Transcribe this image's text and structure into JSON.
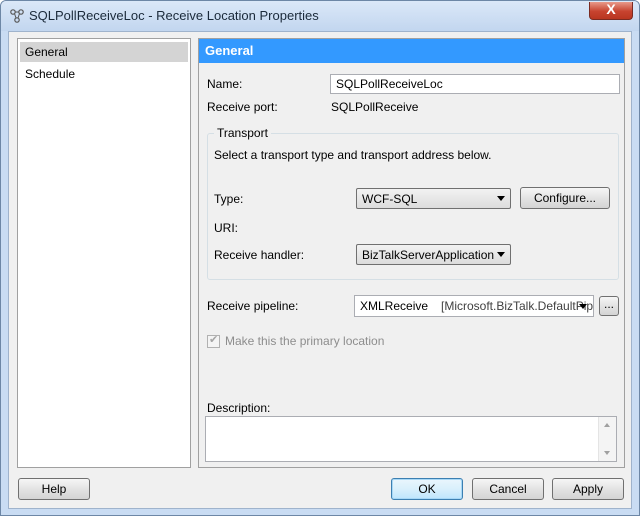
{
  "window": {
    "title": "SQLPollReceiveLoc - Receive Location Properties",
    "close_label": "X"
  },
  "nav": {
    "items": [
      {
        "label": "General"
      },
      {
        "label": "Schedule"
      }
    ]
  },
  "panel": {
    "header": "General",
    "name_label": "Name:",
    "name_value": "SQLPollReceiveLoc",
    "receive_port_label": "Receive port:",
    "receive_port_value": "SQLPollReceive",
    "transport": {
      "title": "Transport",
      "hint": "Select a transport type and transport address below.",
      "type_label": "Type:",
      "type_value": "WCF-SQL",
      "configure_label": "Configure...",
      "uri_label": "URI:",
      "handler_label": "Receive handler:",
      "handler_value": "BizTalkServerApplication"
    },
    "pipeline_label": "Receive pipeline:",
    "pipeline_name": "XMLReceive",
    "pipeline_assembly": "[Microsoft.BizTalk.DefaultPip",
    "pipeline_browse_label": "...",
    "primary_location_label": "Make this the primary location",
    "primary_location_checked": true,
    "description_label": "Description:",
    "description_value": ""
  },
  "footer": {
    "help": "Help",
    "ok": "OK",
    "cancel": "Cancel",
    "apply": "Apply"
  },
  "icons": {
    "app": "receive-location-icon",
    "close": "close-icon",
    "dropdown": "chevron-down-icon",
    "check": "checkmark-icon"
  },
  "colors": {
    "header_bg": "#3399ff",
    "selected_nav": "#d4d4d4",
    "close_button": "#c7432f"
  }
}
